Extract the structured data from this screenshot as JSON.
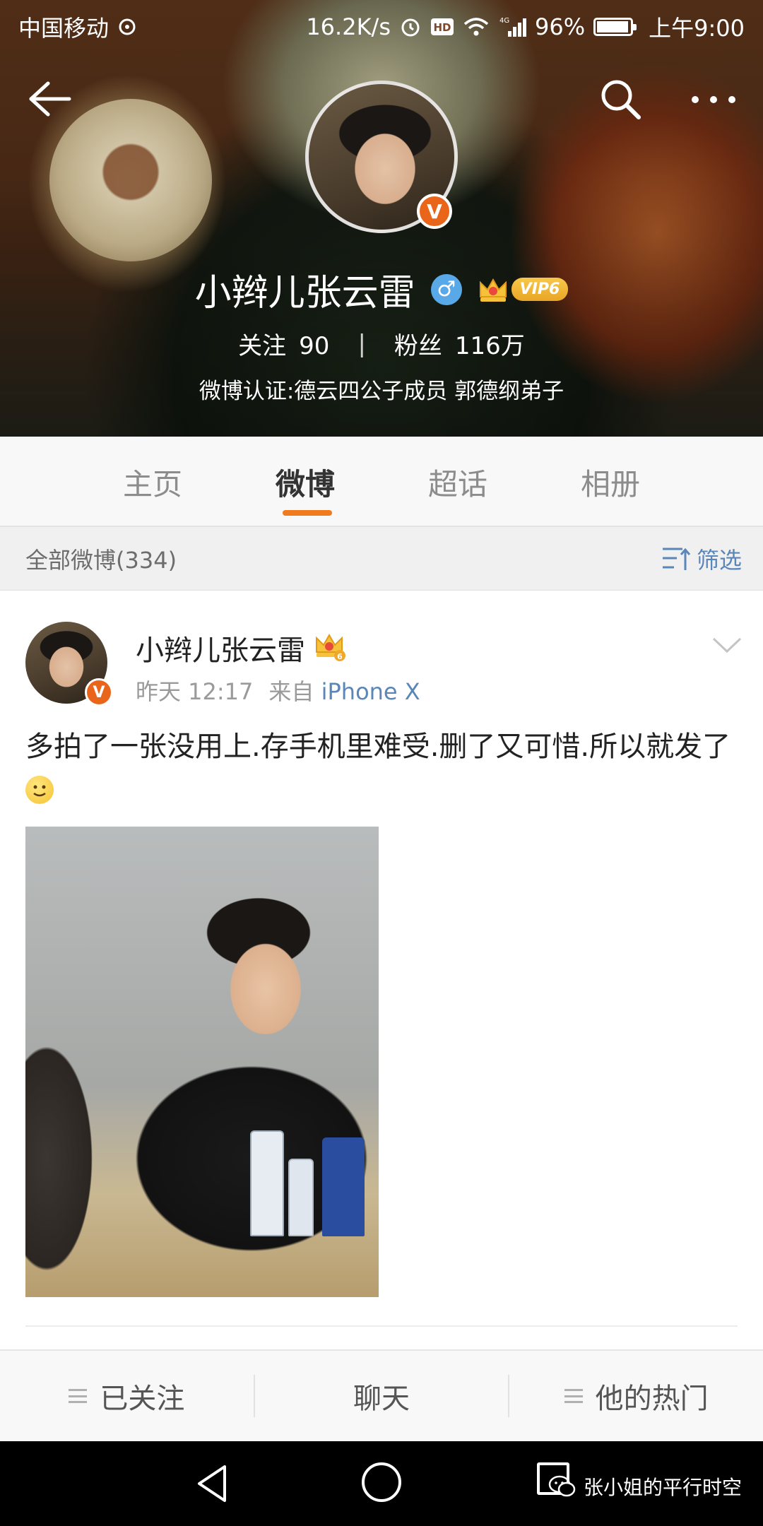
{
  "status_bar": {
    "carrier": "中国移动",
    "net_speed": "16.2K/s",
    "battery": "96%",
    "time": "上午9:00"
  },
  "profile": {
    "name": "小辫儿张云雷",
    "gender_symbol": "♂",
    "vip_label": "VIP6",
    "following_label": "关注",
    "following_count": "90",
    "followers_label": "粉丝",
    "followers_count": "116万",
    "verification": "微博认证:德云四公子成员 郭德纲弟子",
    "verified_badge": "V"
  },
  "tabs": [
    {
      "label": "主页",
      "active": false
    },
    {
      "label": "微博",
      "active": true
    },
    {
      "label": "超话",
      "active": false
    },
    {
      "label": "相册",
      "active": false
    }
  ],
  "filter_bar": {
    "title": "全部微博(334)",
    "filter_label": "筛选"
  },
  "post": {
    "author": "小辫儿张云雷",
    "time": "昨天 12:17",
    "source_prefix": "来自",
    "source": "iPhone X",
    "text": "多拍了一张没用上.存手机里难受.删了又可惜.所以就发了",
    "verified_badge": "V"
  },
  "actions": {
    "followed": "已关注",
    "chat": "聊天",
    "hot": "他的热门"
  },
  "watermark": "张小姐的平行时空",
  "icons": {
    "back": "back-arrow-icon",
    "search": "search-icon",
    "more": "more-icon",
    "filter": "filter-icon",
    "chevron": "chevron-down-icon"
  }
}
